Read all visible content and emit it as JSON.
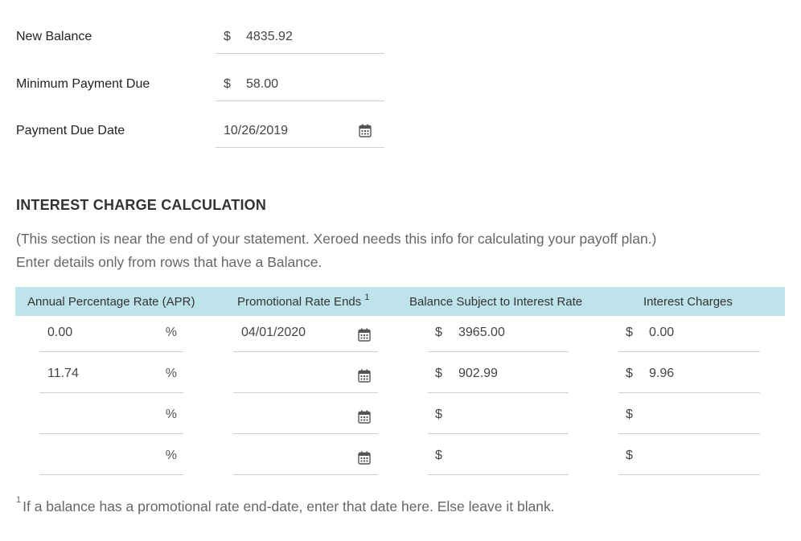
{
  "summary": {
    "new_balance": {
      "label": "New Balance",
      "currency": "$",
      "value": "4835.92"
    },
    "minimum_payment": {
      "label": "Minimum Payment Due",
      "currency": "$",
      "value": "58.00"
    },
    "due_date": {
      "label": "Payment Due Date",
      "value": "10/26/2019",
      "icon": "calendar-icon"
    }
  },
  "interest_section": {
    "title": "INTEREST CHARGE CALCULATION",
    "note_line1": "(This section is near the end of your statement. Xeroed needs this info for calculating your payoff plan.)",
    "note_line2": "Enter details only from rows that have a Balance.",
    "header_color": "#bee3ea",
    "columns": {
      "apr": "Annual Percentage Rate (APR)",
      "promo_end": "Promotional Rate Ends",
      "promo_end_footnote_mark": "1",
      "balance": "Balance Subject to Interest Rate",
      "charges": "Interest Charges"
    },
    "percent_symbol": "%",
    "currency_symbol": "$",
    "rows": [
      {
        "apr": "0.00",
        "promo_end": "04/01/2020",
        "balance": "3965.00",
        "charges": "0.00"
      },
      {
        "apr": "11.74",
        "promo_end": "",
        "balance": "902.99",
        "charges": "9.96"
      },
      {
        "apr": "",
        "promo_end": "",
        "balance": "",
        "charges": ""
      },
      {
        "apr": "",
        "promo_end": "",
        "balance": "",
        "charges": ""
      }
    ],
    "footnote_mark": "1",
    "footnote": "If a balance has a promotional rate end-date, enter that date here. Else leave it blank."
  }
}
